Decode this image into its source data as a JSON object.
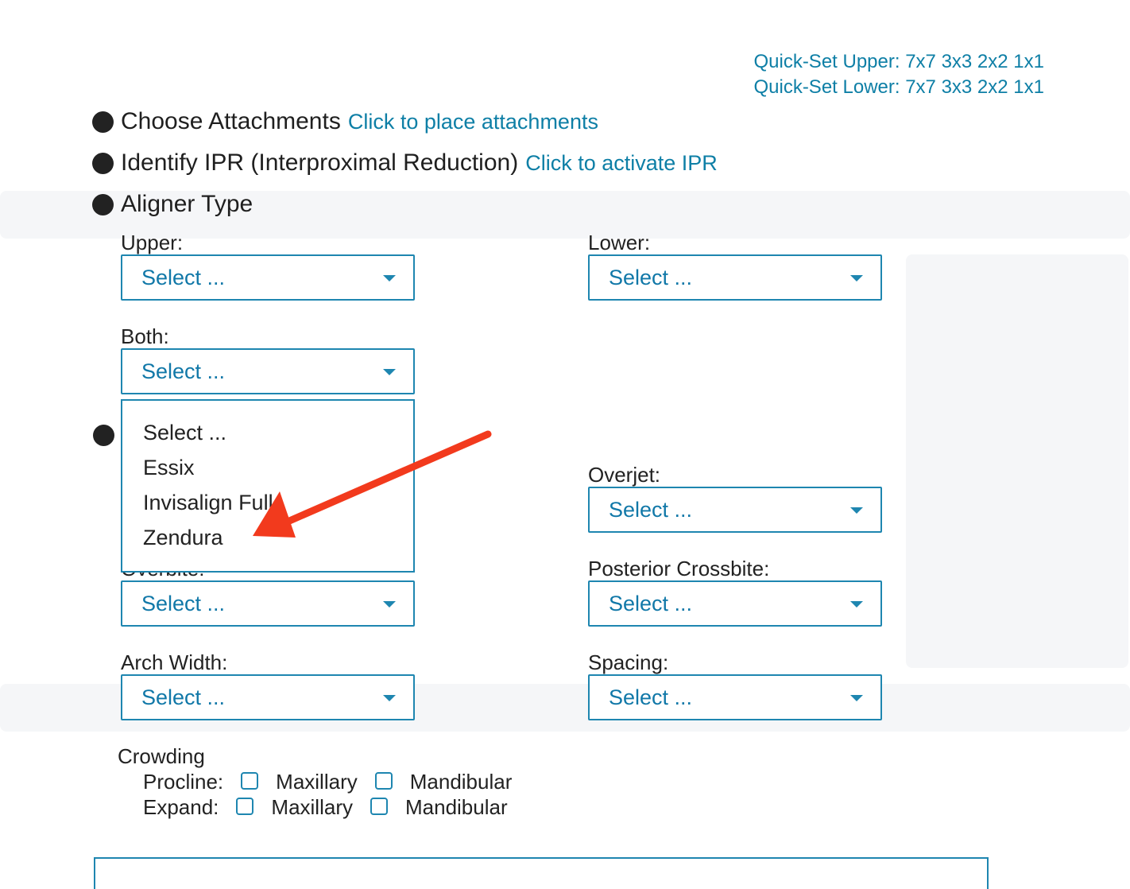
{
  "quickset": {
    "upper": "Quick-Set Upper: 7x7 3x3 2x2 1x1",
    "lower": "Quick-Set Lower: 7x7 3x3 2x2 1x1"
  },
  "sections": {
    "attachments": {
      "title": "Choose Attachments",
      "link": "Click to place attachments"
    },
    "ipr": {
      "title": "Identify IPR (Interproximal Reduction)",
      "link": "Click to activate IPR"
    },
    "aligner": {
      "title": "Aligner Type"
    }
  },
  "fields": {
    "upper": {
      "label": "Upper:",
      "value": "Select ..."
    },
    "lower": {
      "label": "Lower:",
      "value": "Select ..."
    },
    "both": {
      "label": "Both:",
      "value": "Select ..."
    },
    "overjet": {
      "label": "Overjet:",
      "value": "Select ..."
    },
    "overbite": {
      "label": "Overbite:",
      "value": "Select ..."
    },
    "posterior": {
      "label": "Posterior Crossbite:",
      "value": "Select ..."
    },
    "arch": {
      "label": "Arch Width:",
      "value": "Select ..."
    },
    "spacing": {
      "label": "Spacing:",
      "value": "Select ..."
    }
  },
  "dropdown": {
    "options": [
      "Select ...",
      "Essix",
      "Invisalign Full",
      "Zendura"
    ]
  },
  "crowding": {
    "title": "Crowding",
    "procline": "Procline:",
    "expand": "Expand:",
    "maxillary": "Maxillary",
    "mandibular": "Mandibular"
  },
  "colors": {
    "accent": "#1e86b0",
    "link": "#0e7fa6",
    "arrow": "#f23a1d"
  },
  "icons": {
    "caret": "chevron-down-icon",
    "arrow": "red-annotation-arrow"
  }
}
